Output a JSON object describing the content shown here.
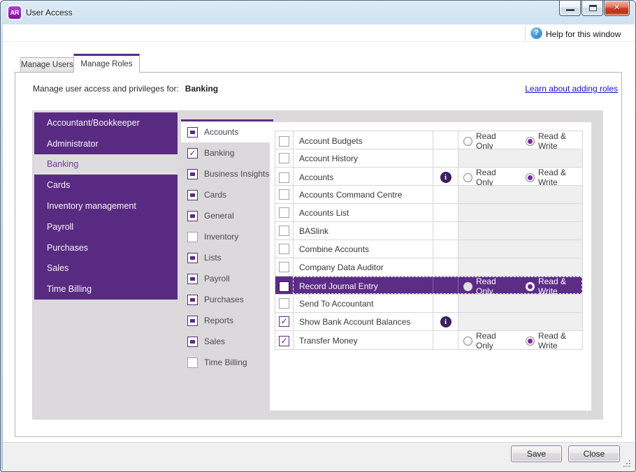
{
  "window": {
    "badge": "AR",
    "title": "User Access"
  },
  "titlebar": {
    "minimize": "minimize",
    "maximize": "maximize",
    "close": "close"
  },
  "icons": {
    "help_glyph": "?",
    "close_glyph": "✕",
    "info_glyph": "i"
  },
  "help": {
    "label": "Help for this window"
  },
  "tabs": {
    "users": "Manage Users",
    "roles": "Manage Roles",
    "active": "Manage Roles"
  },
  "header": {
    "label": "Manage user access and privileges for:",
    "value": "Banking",
    "link": "Learn about adding roles"
  },
  "roles": [
    "Accountant/Bookkeeper",
    "Administrator",
    "Banking",
    "Cards",
    "Inventory management",
    "Payroll",
    "Purchases",
    "Sales",
    "Time Billing"
  ],
  "roles_selected": "Banking",
  "categories": [
    {
      "label": "Accounts",
      "state": "indeterminate",
      "selected": true
    },
    {
      "label": "Banking",
      "state": "checked"
    },
    {
      "label": "Business Insights",
      "state": "indeterminate"
    },
    {
      "label": "Cards",
      "state": "indeterminate"
    },
    {
      "label": "General",
      "state": "indeterminate"
    },
    {
      "label": "Inventory",
      "state": "unchecked"
    },
    {
      "label": "Lists",
      "state": "indeterminate"
    },
    {
      "label": "Payroll",
      "state": "indeterminate"
    },
    {
      "label": "Purchases",
      "state": "indeterminate"
    },
    {
      "label": "Reports",
      "state": "indeterminate"
    },
    {
      "label": "Sales",
      "state": "indeterminate"
    },
    {
      "label": "Time Billing",
      "state": "unchecked"
    }
  ],
  "access_labels": {
    "read_only": "Read Only",
    "read_write": "Read & Write"
  },
  "functions": [
    {
      "label": "Account Budgets",
      "checked": false,
      "info": false,
      "access": "read_write"
    },
    {
      "label": "Account History",
      "checked": false,
      "info": false,
      "access": null
    },
    {
      "label": "Accounts",
      "checked": false,
      "info": true,
      "access": "read_write"
    },
    {
      "label": "Accounts Command Centre",
      "checked": false,
      "info": false,
      "access": null
    },
    {
      "label": "Accounts List",
      "checked": false,
      "info": false,
      "access": null
    },
    {
      "label": "BASlink",
      "checked": false,
      "info": false,
      "access": null
    },
    {
      "label": "Combine Accounts",
      "checked": false,
      "info": false,
      "access": null
    },
    {
      "label": "Company Data Auditor",
      "checked": false,
      "info": false,
      "access": null
    },
    {
      "label": "Record Journal Entry",
      "checked": false,
      "info": false,
      "access": "read_write",
      "selected": true
    },
    {
      "label": "Send To Accountant",
      "checked": false,
      "info": false,
      "access": null
    },
    {
      "label": "Show Bank Account Balances",
      "checked": true,
      "info": true,
      "access": null
    },
    {
      "label": "Transfer Money",
      "checked": true,
      "info": false,
      "access": "read_write"
    }
  ],
  "footer": {
    "save": "Save",
    "close": "Close"
  },
  "colors": {
    "brand_purple": "#5a2b82",
    "selection_purple": "#5c2d87",
    "radio_dot_purple": "#7429a2",
    "info_icon_purple": "#3c1e5e",
    "link_blue": "#1414cc",
    "workspace_gray": "#dbd9db"
  }
}
